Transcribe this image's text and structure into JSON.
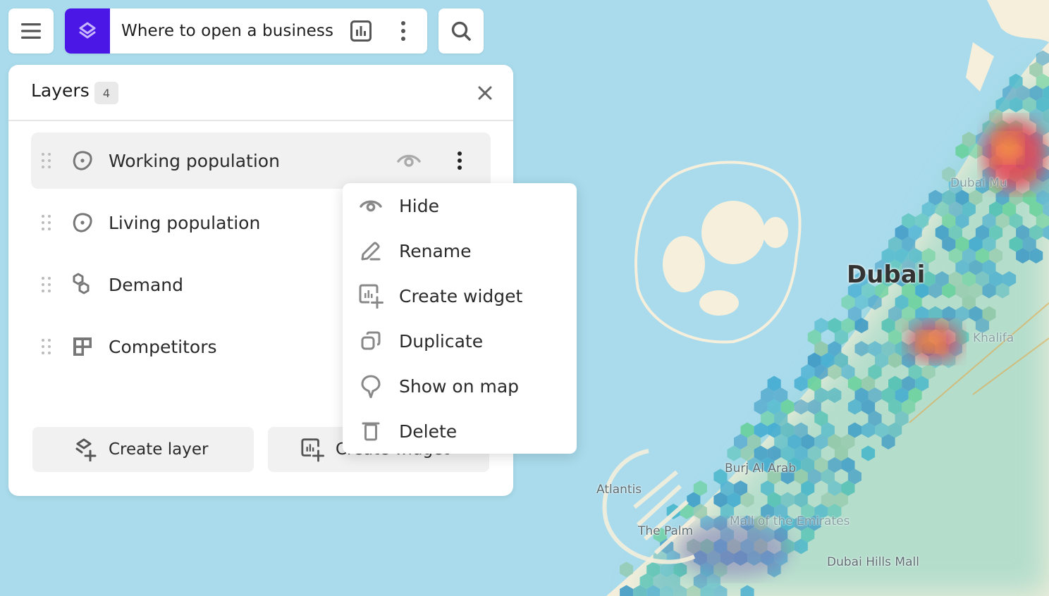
{
  "topbar": {
    "menu_icon": "hamburger-menu-icon",
    "project_icon": "layers-stack-icon",
    "project_title": "Where to open a business",
    "dashboard_icon": "bar-chart-icon",
    "more_icon": "vertical-dots-icon",
    "search_icon": "search-icon",
    "accent_color": "#4a17e6"
  },
  "layers_panel": {
    "title": "Layers",
    "count": "4",
    "close_icon": "close-icon",
    "layers": [
      {
        "label": "Working population",
        "icon": "map-area-pin-icon",
        "active": true
      },
      {
        "label": "Living population",
        "icon": "map-area-pin-icon",
        "active": false
      },
      {
        "label": "Demand",
        "icon": "hexagons-icon",
        "active": false
      },
      {
        "label": "Competitors",
        "icon": "grid-blocks-icon",
        "active": false
      }
    ],
    "buttons": {
      "create_layer": "Create layer",
      "create_widget": "Create widget"
    }
  },
  "context_menu": {
    "items": [
      {
        "label": "Hide",
        "icon": "eye-icon"
      },
      {
        "label": "Rename",
        "icon": "pencil-icon"
      },
      {
        "label": "Create widget",
        "icon": "add-widget-icon"
      },
      {
        "label": "Duplicate",
        "icon": "duplicate-icon"
      },
      {
        "label": "Show on map",
        "icon": "map-pin-icon"
      },
      {
        "label": "Delete",
        "icon": "trash-icon"
      }
    ]
  },
  "map": {
    "labels": {
      "city": "Dubai",
      "atlantis": "Atlantis",
      "the_palm": "The Palm",
      "burj_al_arab": "Burj Al Arab",
      "mall_of_emirates": "Mall of the Emirates",
      "dubai_hills_mall": "Dubai Hills Mall",
      "dubai_mu": "Dubai Mu",
      "khalifa": "Khalifa"
    },
    "colors": {
      "water": "#a9dbec",
      "land": "#f5efdc"
    }
  }
}
